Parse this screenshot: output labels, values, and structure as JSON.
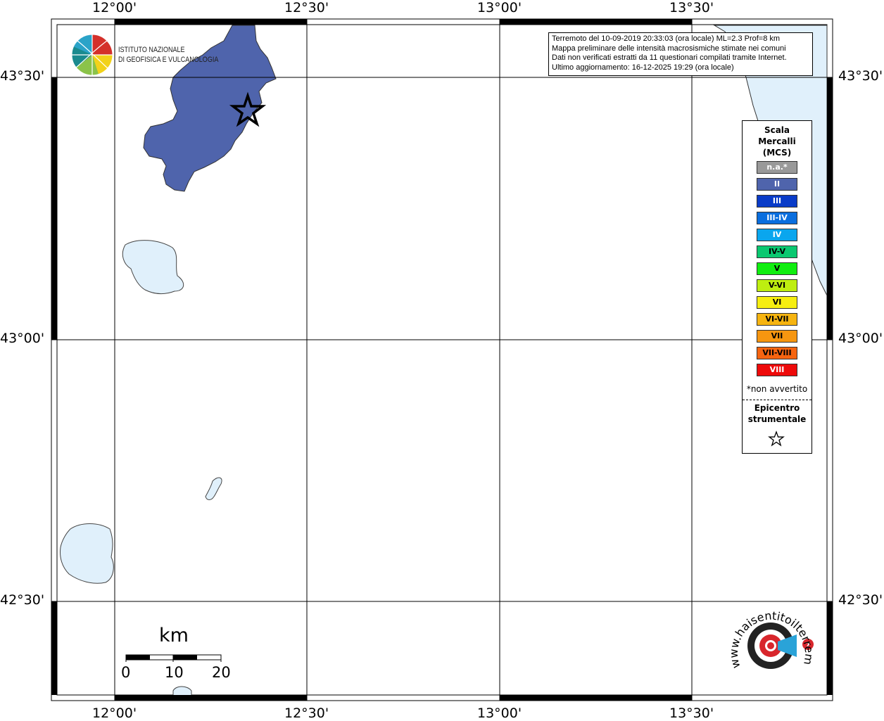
{
  "map": {
    "longitude_labels": [
      "12°00'",
      "12°30'",
      "13°00'",
      "13°30'"
    ],
    "latitude_labels": [
      "43°30'",
      "43°00'",
      "42°30'"
    ],
    "institute_logo": {
      "line1": "ISTITUTO NAZIONALE",
      "line2": "DI GEOFISICA E VULCANOLOGIA"
    },
    "info_box": {
      "line1": "Terremoto del 10-09-2019 20:33:03 (ora locale) ML=2.3 Prof=8 km",
      "line2": "Mappa preliminare delle intensità macrosismiche stimate nei comuni",
      "line3": "Dati non verificati estratti da 11 questionari compilati tramite Internet.",
      "line4": "Ultimo aggiornamento: 16-12-2025 19:29 (ora locale)"
    },
    "legend": {
      "title_line1": "Scala",
      "title_line2": "Mercalli",
      "title_line3": "(MCS)",
      "entries": [
        {
          "label": "n.a.*",
          "color": "#999999",
          "text_color": "#ffffff"
        },
        {
          "label": "II",
          "color": "#4f64ac",
          "text_color": "#ffffff"
        },
        {
          "label": "III",
          "color": "#0a3cc8",
          "text_color": "#ffffff"
        },
        {
          "label": "III-IV",
          "color": "#0a6ede",
          "text_color": "#ffffff"
        },
        {
          "label": "IV",
          "color": "#0aa6ee",
          "text_color": "#ffffff"
        },
        {
          "label": "IV-V",
          "color": "#0ac870",
          "text_color": "#000000"
        },
        {
          "label": "V",
          "color": "#10ee10",
          "text_color": "#000000"
        },
        {
          "label": "V-VI",
          "color": "#beee10",
          "text_color": "#000000"
        },
        {
          "label": "VI",
          "color": "#f6ee10",
          "text_color": "#000000"
        },
        {
          "label": "VI-VII",
          "color": "#f6b410",
          "text_color": "#000000"
        },
        {
          "label": "VII",
          "color": "#f69610",
          "text_color": "#000000"
        },
        {
          "label": "VII-VIII",
          "color": "#f66410",
          "text_color": "#000000"
        },
        {
          "label": "VIII",
          "color": "#ee0a0a",
          "text_color": "#ffffff"
        }
      ],
      "note": "*non avvertito",
      "epicentre_line1": "Epicentro",
      "epicentre_line2": "strumentale"
    },
    "scale_bar": {
      "unit": "km",
      "ticks": [
        "0",
        "10",
        "20"
      ]
    },
    "watermark": {
      "text": "www.haisentitoilterremoto.it"
    },
    "colors": {
      "intensity_II": "#4f64ac",
      "water": "#e0f0fb",
      "grid": "#000000"
    }
  }
}
